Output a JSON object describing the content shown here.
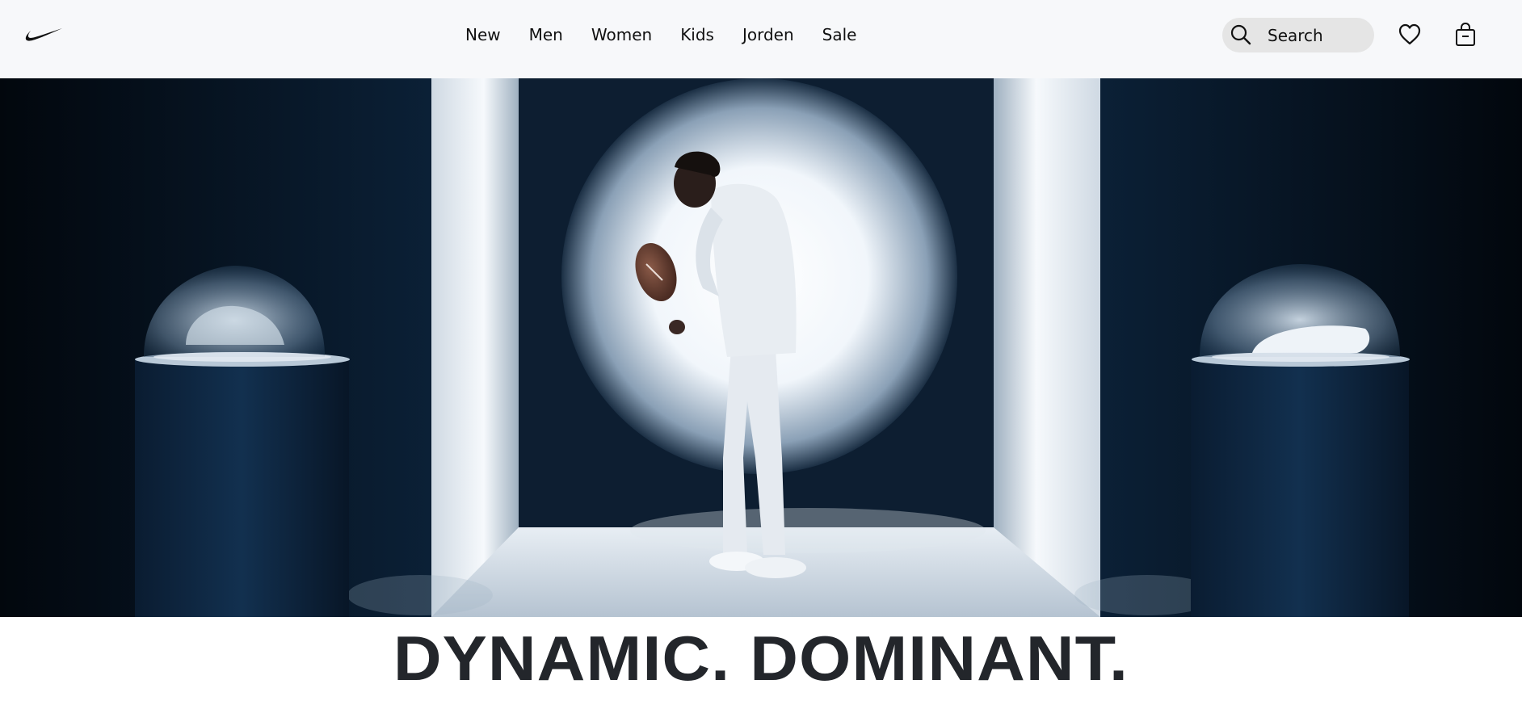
{
  "header": {
    "logo": "nike-swoosh-logo",
    "nav": [
      {
        "label": "New"
      },
      {
        "label": "Men"
      },
      {
        "label": "Women"
      },
      {
        "label": "Kids"
      },
      {
        "label": "Jorden"
      },
      {
        "label": "Sale"
      }
    ],
    "search": {
      "placeholder": "Search",
      "icon": "search-icon"
    },
    "favorites_icon": "heart-icon",
    "bag_icon": "shopping-bag-icon"
  },
  "hero": {
    "image": "football-player-display-scene",
    "colors": {
      "background": "#051426",
      "spotlight": "#f4f8fc",
      "panel": "#dfe7ef"
    }
  },
  "headline": {
    "title": "DYNAMIC. DOMINANT.",
    "subtitle": ""
  }
}
